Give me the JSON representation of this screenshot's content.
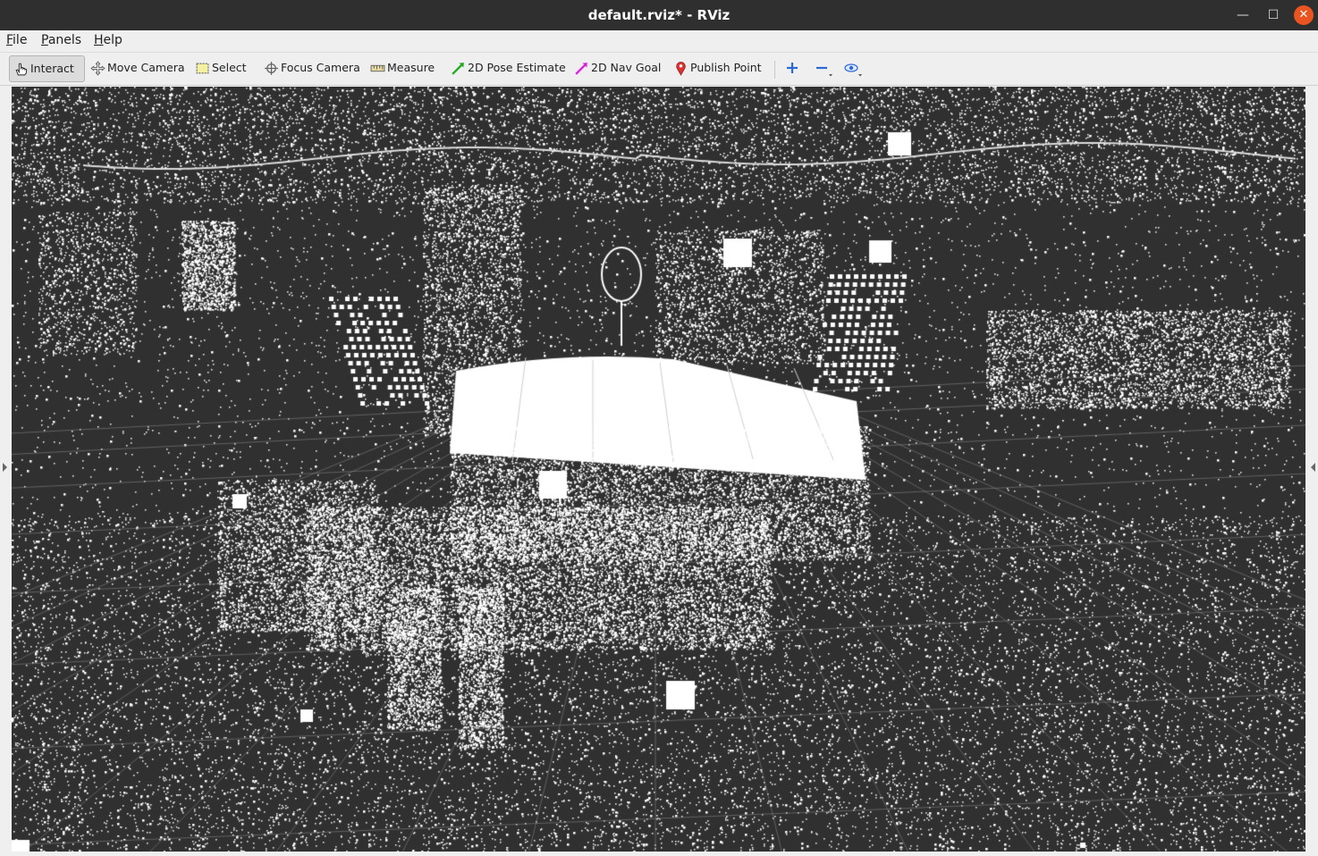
{
  "window": {
    "title": "default.rviz* - RViz",
    "minimize_glyph": "—",
    "maximize_glyph": "☐",
    "close_glyph": "✕"
  },
  "menu": {
    "file": {
      "mnemonic": "F",
      "rest": "ile"
    },
    "panels": {
      "mnemonic": "P",
      "rest": "anels"
    },
    "help": {
      "mnemonic": "H",
      "rest": "elp"
    }
  },
  "toolbar": {
    "interact": {
      "label": "Interact",
      "icon": "hand-cursor-icon",
      "active": true
    },
    "move_camera": {
      "label": "Move Camera",
      "icon": "move-camera-icon"
    },
    "select": {
      "label": "Select",
      "icon": "select-rect-icon"
    },
    "focus_camera": {
      "label": "Focus Camera",
      "icon": "crosshair-icon"
    },
    "measure": {
      "label": "Measure",
      "icon": "ruler-icon"
    },
    "pose_estimate": {
      "label": "2D Pose Estimate",
      "icon": "green-arrow-icon",
      "color": "#22aa22"
    },
    "nav_goal": {
      "label": "2D Nav Goal",
      "icon": "magenta-arrow-icon",
      "color": "#dd22dd"
    },
    "publish_point": {
      "label": "Publish Point",
      "icon": "map-pin-icon",
      "color": "#dd3333"
    },
    "add_tool": {
      "icon": "plus-icon",
      "color": "#2a6ad6"
    },
    "remove_tool": {
      "icon": "minus-icon",
      "color": "#2a6ad6"
    },
    "views": {
      "icon": "eye-icon",
      "color": "#2a6ad6"
    }
  },
  "viewport": {
    "background": "#303030",
    "grid_color": "#8a8a8a",
    "point_color": "#ffffff",
    "content": "point-cloud"
  }
}
